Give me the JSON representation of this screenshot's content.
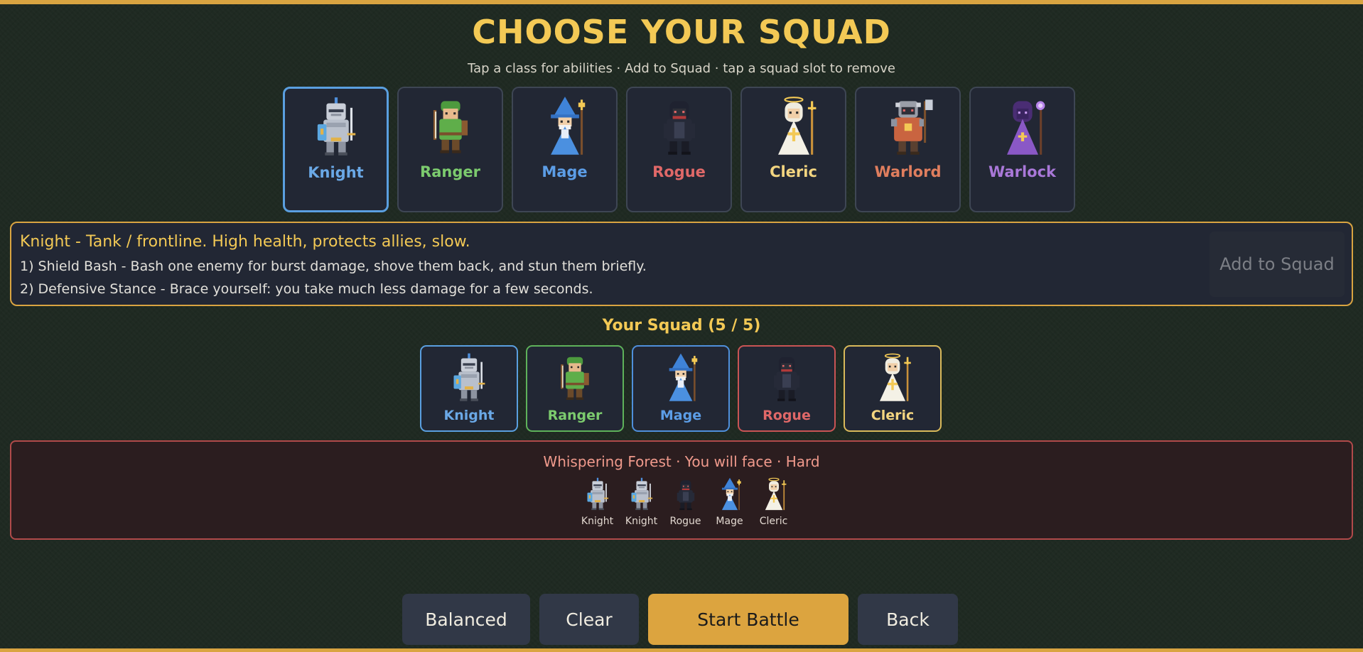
{
  "title": "CHOOSE YOUR SQUAD",
  "subtitle": "Tap a class for abilities  ·  Add to Squad  ·  tap a squad slot to remove",
  "classes": [
    {
      "name": "Knight",
      "color": "#6aa8e6",
      "icon": "knight-sprite-icon"
    },
    {
      "name": "Ranger",
      "color": "#7ccb6e",
      "icon": "ranger-sprite-icon"
    },
    {
      "name": "Mage",
      "color": "#5c9de6",
      "icon": "mage-sprite-icon"
    },
    {
      "name": "Rogue",
      "color": "#e06868",
      "icon": "rogue-sprite-icon"
    },
    {
      "name": "Cleric",
      "color": "#f3d580",
      "icon": "cleric-sprite-icon"
    },
    {
      "name": "Warlord",
      "color": "#e07e5e",
      "icon": "warlord-sprite-icon"
    },
    {
      "name": "Warlock",
      "color": "#a978d8",
      "icon": "warlock-sprite-icon"
    }
  ],
  "selected_class": "Knight",
  "info": {
    "heading": "Knight  -  Tank / frontline. High health, protects allies, slow.",
    "ability1": "1) Shield Bash - Bash one enemy for burst damage, shove them back, and stun them briefly.",
    "ability2": "2) Defensive Stance - Brace yourself: you take much less damage for a few seconds.",
    "add_button": "Add to Squad"
  },
  "squad": {
    "title": "Your Squad  (5 / 5)",
    "members": [
      {
        "name": "Knight",
        "color": "#6aa8e6",
        "border": "#5a9fe0"
      },
      {
        "name": "Ranger",
        "color": "#7ccb6e",
        "border": "#5eb25a"
      },
      {
        "name": "Mage",
        "color": "#5c9de6",
        "border": "#4f8fdb"
      },
      {
        "name": "Rogue",
        "color": "#e06868",
        "border": "#c95454"
      },
      {
        "name": "Cleric",
        "color": "#f3d580",
        "border": "#d9b95a"
      }
    ]
  },
  "enemies": {
    "heading": "Whispering Forest  ·  You will face  ·  Hard",
    "list": [
      "Knight",
      "Knight",
      "Rogue",
      "Mage",
      "Cleric"
    ]
  },
  "buttons": {
    "balanced": "Balanced",
    "clear": "Clear",
    "start": "Start Battle",
    "back": "Back"
  }
}
